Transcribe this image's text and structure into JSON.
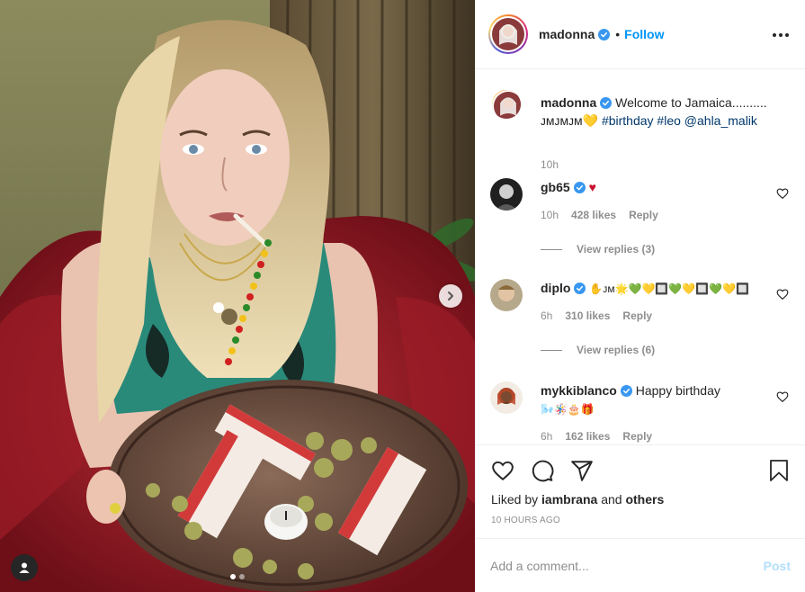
{
  "header": {
    "username": "madonna",
    "separator": "•",
    "follow_label": "Follow",
    "more_icon": "more-horizontal-icon"
  },
  "caption": {
    "username": "madonna",
    "text": "Welcome to Jamaica..........",
    "line2_prefix": "ᴊᴍᴊᴍᴊᴍ💛",
    "hashtag1": "#birthday",
    "hashtag2": "#leo",
    "mention": "@ahla_malik",
    "time": "10h"
  },
  "comments": [
    {
      "username": "gb65",
      "text": "♥",
      "time": "10h",
      "likes": "428 likes",
      "reply_label": "Reply",
      "view_replies": "View replies (3)"
    },
    {
      "username": "diplo",
      "text": "✋ᴊᴍ🌟💚💛🔲💚💛🔲💚💛🔲",
      "time": "6h",
      "likes": "310 likes",
      "reply_label": "Reply",
      "view_replies": "View replies (6)"
    },
    {
      "username": "mykkiblanco",
      "text": "Happy birthday",
      "text_line2": "🌬️🪅🎂🎁",
      "time": "6h",
      "likes": "162 likes",
      "reply_label": "Reply"
    }
  ],
  "actions": {
    "like_icon": "heart-icon",
    "comment_icon": "comment-icon",
    "share_icon": "share-icon",
    "save_icon": "bookmark-icon"
  },
  "liked_by": {
    "prefix": "Liked by",
    "user": "iambrana",
    "conj": "and",
    "others": "others"
  },
  "timestamp": "10 HOURS AGO",
  "add_comment": {
    "placeholder": "Add a comment...",
    "post_label": "Post"
  },
  "colors": {
    "accent": "#0095f6",
    "post_disabled": "#b2dffc",
    "heart_red": "#c8102e",
    "muted": "#8e8e8e"
  }
}
